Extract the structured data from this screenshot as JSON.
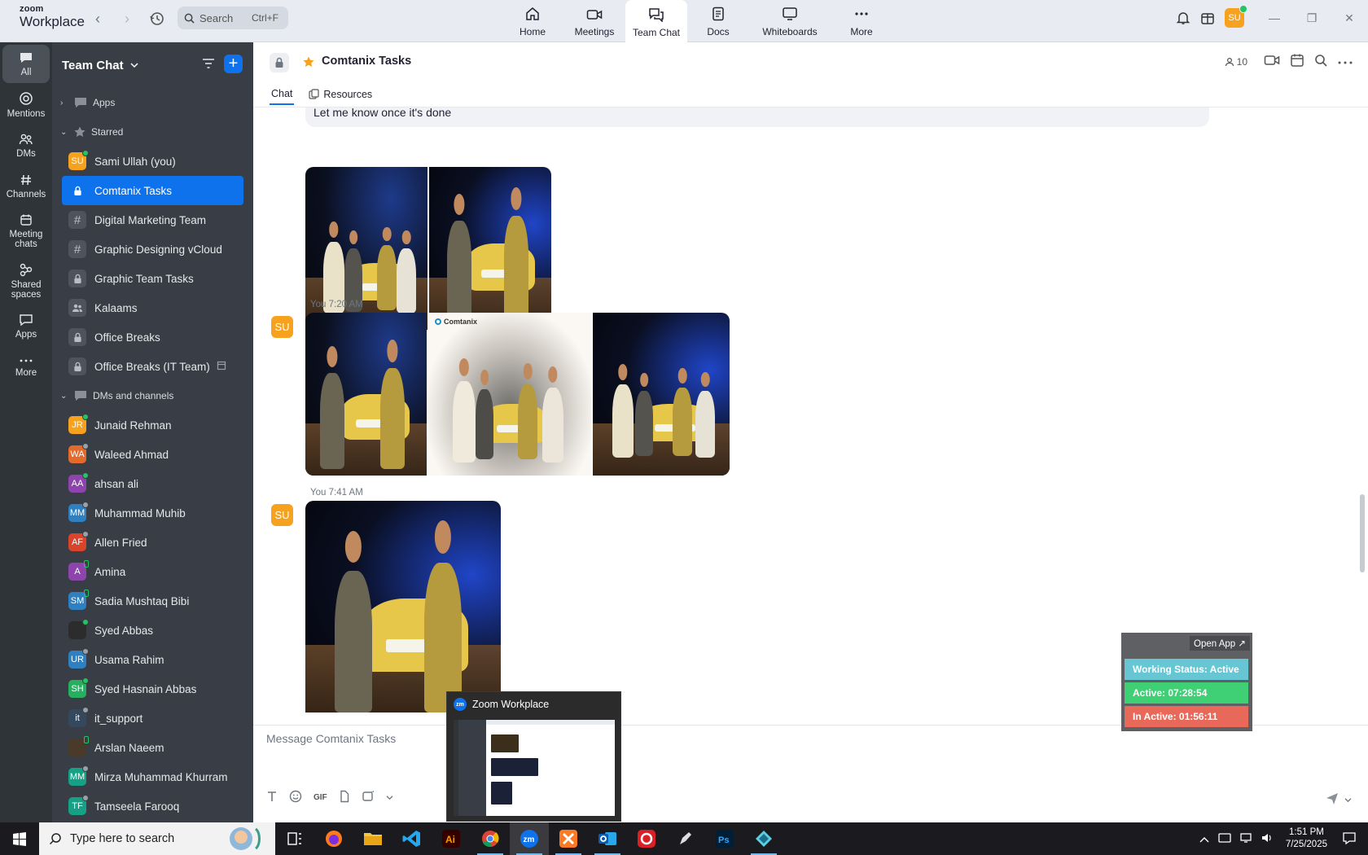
{
  "app": {
    "brand_top": "zoom",
    "brand_bottom": "Workplace"
  },
  "search": {
    "placeholder": "Search",
    "shortcut": "Ctrl+F"
  },
  "topnav": [
    {
      "label": "Home"
    },
    {
      "label": "Meetings"
    },
    {
      "label": "Team Chat"
    },
    {
      "label": "Docs"
    },
    {
      "label": "Whiteboards"
    },
    {
      "label": "More"
    }
  ],
  "user": {
    "initials": "SU"
  },
  "rail": {
    "all": "All",
    "mentions": "Mentions",
    "dms": "DMs",
    "channels": "Channels",
    "meeting_chats": "Meeting chats",
    "shared_spaces": "Shared spaces",
    "apps": "Apps",
    "more": "More"
  },
  "sidebar": {
    "title": "Team Chat",
    "sections": {
      "apps": "Apps",
      "starred": "Starred",
      "dms": "DMs and channels"
    },
    "starred": [
      {
        "label": "Sami Ullah (you)",
        "initials": "SU",
        "color": "#f7a21e",
        "status": "on"
      },
      {
        "label": "Comtanix Tasks",
        "kind": "lock"
      },
      {
        "label": "Digital Marketing Team",
        "kind": "hash"
      },
      {
        "label": "Graphic Designing vCloud",
        "kind": "hash"
      },
      {
        "label": "Graphic Team Tasks",
        "kind": "lock"
      },
      {
        "label": "Kalaams",
        "kind": "group"
      },
      {
        "label": "Office Breaks",
        "kind": "lock"
      },
      {
        "label": "Office Breaks (IT Team)",
        "kind": "lock"
      }
    ],
    "dms": [
      {
        "label": "Junaid Rehman",
        "initials": "JR",
        "color": "#f7a21e",
        "status": "on"
      },
      {
        "label": "Waleed Ahmad",
        "initials": "WA",
        "color": "#e26a2c",
        "status": "off"
      },
      {
        "label": "ahsan ali",
        "initials": "AA",
        "color": "#8e44ad",
        "status": "on"
      },
      {
        "label": "Muhammad Muhib",
        "initials": "MM",
        "color": "#2f80c0",
        "status": "off"
      },
      {
        "label": "Allen Fried",
        "initials": "AF",
        "color": "#d9442b",
        "status": "off"
      },
      {
        "label": "Amina",
        "initials": "A",
        "color": "#8e44ad",
        "status": "mob"
      },
      {
        "label": "Sadia Mushtaq Bibi",
        "initials": "SM",
        "color": "#2f80c0",
        "status": "mob"
      },
      {
        "label": "Syed Abbas",
        "initials": "",
        "color": "#2c2c2c",
        "status": "on"
      },
      {
        "label": "Usama Rahim",
        "initials": "UR",
        "color": "#2f80c0",
        "status": "off"
      },
      {
        "label": "Syed Hasnain Abbas",
        "initials": "SH",
        "color": "#27ae60",
        "status": "on"
      },
      {
        "label": "it_support",
        "initials": "it",
        "color": "#34495e",
        "status": "off"
      },
      {
        "label": "Arslan Naeem",
        "initials": "",
        "color": "#4a3a2a",
        "status": "mob"
      },
      {
        "label": "Mirza Muhammad Khurram",
        "initials": "MM",
        "color": "#16a085",
        "status": "off"
      },
      {
        "label": "Tamseela Farooq",
        "initials": "TF",
        "color": "#16a085",
        "status": "off"
      }
    ]
  },
  "channel": {
    "title": "Comtanix Tasks",
    "members": "10",
    "tabs": [
      "Chat",
      "Resources"
    ]
  },
  "messages": {
    "prev_text": "Let me know once it's done",
    "m1_meta": "You 7:20 AM",
    "m2_meta": "You 7:41 AM",
    "logo_text": "Comtanix"
  },
  "compose": {
    "placeholder": "Message Comtanix Tasks",
    "gif": "GIF"
  },
  "status_widget": {
    "open": "Open App ↗",
    "working": "Working Status: Active",
    "active": "Active: 07:28:54",
    "inactive": "In Active: 01:56:11"
  },
  "thumbnail": {
    "title": "Zoom Workplace",
    "icon_text": "zm"
  },
  "taskbar": {
    "search_placeholder": "Type here to search",
    "time": "1:51 PM",
    "date": "7/25/2025"
  }
}
